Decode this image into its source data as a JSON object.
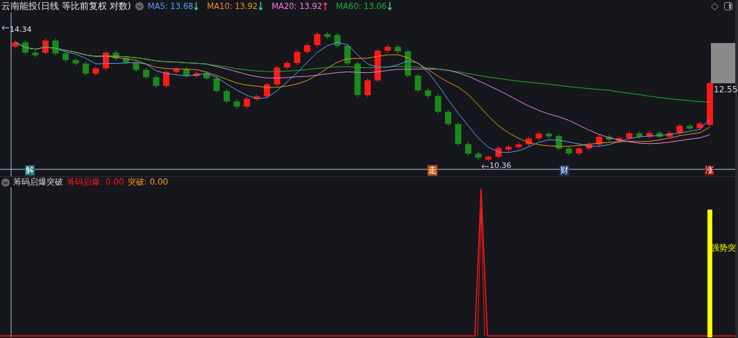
{
  "header": {
    "title": "云南能投(日线 等比前复权 对数)",
    "indicators": [
      {
        "name": "MA5:",
        "value": "13.68",
        "rising": false,
        "color": "#5b9cf8"
      },
      {
        "name": "MA10:",
        "value": "13.92",
        "rising": false,
        "color": "#f0901c"
      },
      {
        "name": "MA20:",
        "value": "13.92",
        "rising": true,
        "color": "#f080e0"
      },
      {
        "name": "MA60:",
        "value": "13.06",
        "rising": false,
        "color": "#20b030"
      }
    ]
  },
  "main_chart": {
    "high_label": "14.34",
    "low_label": "10.36",
    "last_label": "12.55",
    "markers": [
      {
        "text": "解",
        "color": "#0e6e6e"
      },
      {
        "text": "走",
        "color": "#c0561a"
      },
      {
        "text": "财",
        "color": "#1a3a6e"
      },
      {
        "text": "涨",
        "color": "#7a0a0a"
      }
    ]
  },
  "sub_panel": {
    "title": "筹码启爆突破",
    "values": [
      {
        "label": "筹码启爆:",
        "value": "0.00",
        "color": "#ff1a1a"
      },
      {
        "label": "突破:",
        "value": "0.00",
        "color": "#ff9a1e"
      }
    ],
    "signal_label": "强势突"
  }
}
